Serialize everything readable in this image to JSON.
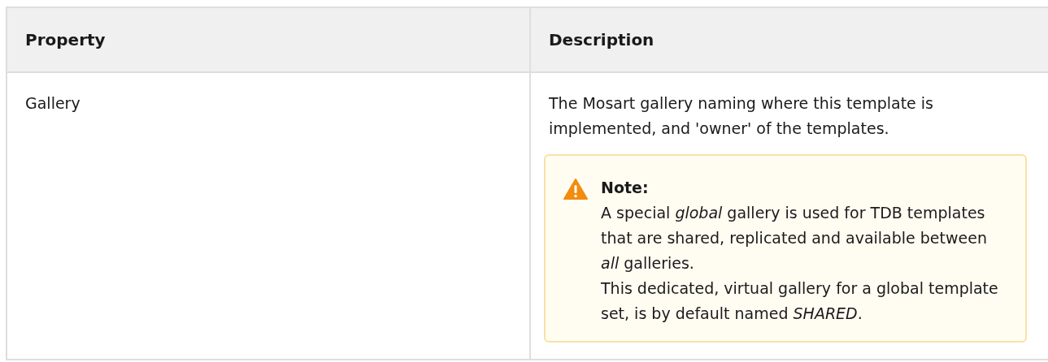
{
  "table": {
    "columns": [
      "Property",
      "Description"
    ],
    "rows": [
      {
        "property": "Gallery",
        "description": "The Mosart gallery naming where this template is implemented, and 'owner' of the templates.",
        "note": {
          "title": "Note:",
          "paragraphs": [
            "A special *global* gallery is used for TDB templates that are shared, replicated and available between *all* galleries.",
            "This dedicated, virtual gallery for a global template set, is by default named *SHARED*."
          ]
        }
      }
    ]
  }
}
